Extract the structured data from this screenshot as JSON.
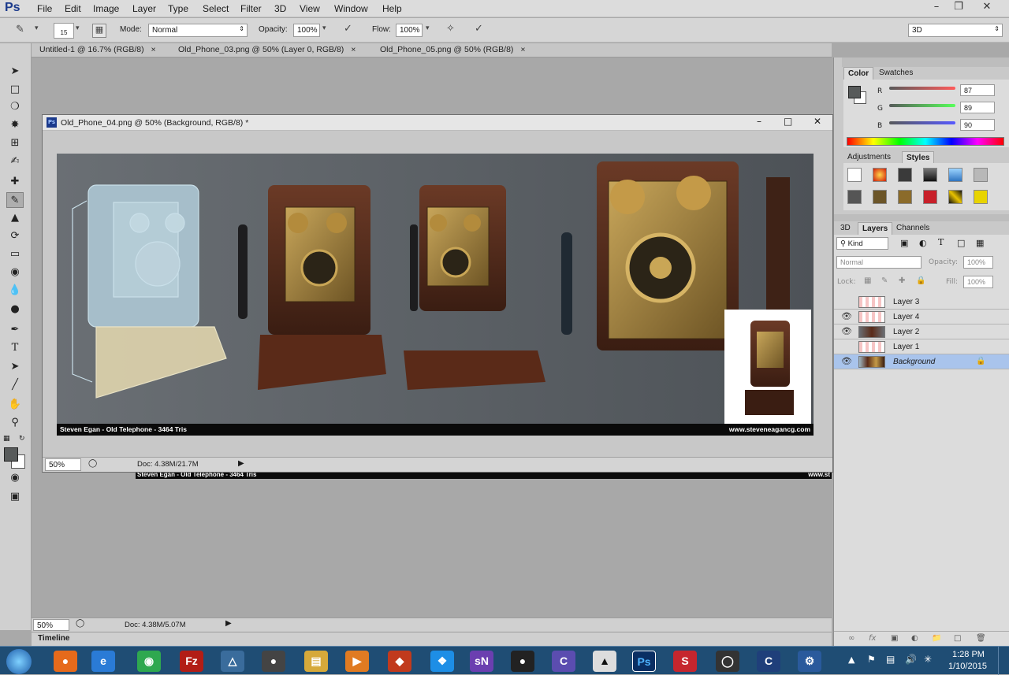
{
  "app": {
    "logo": "Ps"
  },
  "menu": [
    "File",
    "Edit",
    "Image",
    "Layer",
    "Type",
    "Select",
    "Filter",
    "3D",
    "View",
    "Window",
    "Help"
  ],
  "options": {
    "brush_size": "15",
    "mode_label": "Mode:",
    "mode_value": "Normal",
    "opacity_label": "Opacity:",
    "opacity_value": "100%",
    "flow_label": "Flow:",
    "flow_value": "100%",
    "workspace": "3D"
  },
  "tabs": [
    {
      "label": "Untitled-1 @ 16.7% (RGB/8)"
    },
    {
      "label": "Old_Phone_03.png @ 50% (Layer 0, RGB/8)"
    },
    {
      "label": "Old_Phone_05.png @ 50% (RGB/8)"
    }
  ],
  "document": {
    "title": "Old_Phone_04.png @ 50% (Background, RGB/8) *",
    "caption_left": "Steven Egan - Old Telephone - 3464 Tris",
    "caption_right": "www.steveneagancg.com",
    "zoom": "50%",
    "doc_size": "Doc: 4.38M/21.7M"
  },
  "background_strip": {
    "caption_left": "Steven Egan - Old Telephone - 3464 Tris",
    "caption_right": "www.st"
  },
  "workspace_status": {
    "zoom": "50%",
    "doc_size": "Doc: 4.38M/5.07M"
  },
  "timeline": {
    "label": "Timeline"
  },
  "color_panel": {
    "tabs": [
      "Color",
      "Swatches"
    ],
    "r_label": "R",
    "r_value": "87",
    "g_label": "G",
    "g_value": "89",
    "b_label": "B",
    "b_value": "90",
    "fg_color": "#575a5a"
  },
  "adjustments_panel": {
    "tabs": [
      "Adjustments",
      "Styles"
    ]
  },
  "layers_panel": {
    "tabs": [
      "3D",
      "Layers",
      "Channels"
    ],
    "kind_label": "Kind",
    "blend_mode": "Normal",
    "opacity_label": "Opacity:",
    "opacity_value": "100%",
    "lock_label": "Lock:",
    "fill_label": "Fill:",
    "fill_value": "100%",
    "layers": [
      {
        "name": "Layer 3",
        "visible": false
      },
      {
        "name": "Layer 4",
        "visible": true
      },
      {
        "name": "Layer 2",
        "visible": true
      },
      {
        "name": "Layer 1",
        "visible": false
      },
      {
        "name": "Background",
        "visible": true,
        "selected": true
      }
    ]
  },
  "taskbar": {
    "time": "1:28 PM",
    "date": "1/10/2015"
  }
}
